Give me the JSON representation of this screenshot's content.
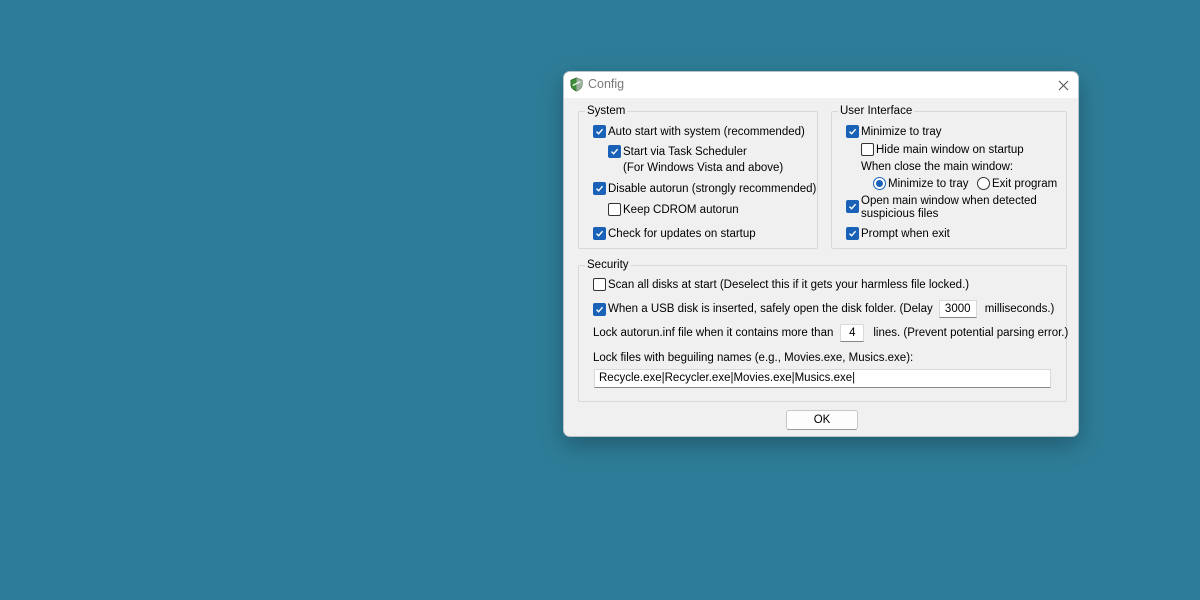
{
  "window": {
    "title": "Config",
    "icon": "shield-icon",
    "close_icon": "close-icon"
  },
  "system": {
    "label": "System",
    "auto_start": {
      "label": "Auto start with system (recommended)",
      "checked": true
    },
    "task_scheduler": {
      "label": "Start via Task Scheduler",
      "note": "(For Windows Vista and above)",
      "checked": true
    },
    "disable_autorun": {
      "label": "Disable autorun (strongly recommended)",
      "checked": true
    },
    "keep_cdrom": {
      "label": "Keep CDROM autorun",
      "checked": false
    },
    "check_updates": {
      "label": "Check for updates on startup",
      "checked": true
    }
  },
  "ui": {
    "label": "User Interface",
    "minimize_tray": {
      "label": "Minimize to tray",
      "checked": true
    },
    "hide_main": {
      "label": "Hide main window on startup",
      "checked": false
    },
    "close_label": "When close the main window:",
    "close_minimize": {
      "label": "Minimize to tray",
      "selected": true
    },
    "close_exit": {
      "label": "Exit program",
      "selected": false
    },
    "open_main": {
      "label_line1": "Open main window when detected",
      "label_line2": "suspicious files",
      "checked": true
    },
    "prompt_exit": {
      "label": "Prompt when exit",
      "checked": true
    }
  },
  "security": {
    "label": "Security",
    "scan_all": {
      "label": "Scan all disks at start (Deselect this if it gets your harmless file locked.)",
      "checked": false
    },
    "usb_open": {
      "label_before": "When a USB disk is inserted, safely open the disk folder. (Delay",
      "delay": "3000",
      "label_after": "milliseconds.)",
      "checked": true
    },
    "lock_autorun": {
      "label_before": "Lock autorun.inf file when it contains more than",
      "lines": "4",
      "label_after": "lines. (Prevent potential parsing error.)"
    },
    "lock_names_label": "Lock files with beguiling names (e.g., Movies.exe, Musics.exe):",
    "lock_names_value": "Recycle.exe|Recycler.exe|Movies.exe|Musics.exe|"
  },
  "buttons": {
    "ok": "OK"
  },
  "colors": {
    "desktop": "#2e7d98",
    "accent": "#1a62b7",
    "dialog": "#f0f0f0"
  }
}
